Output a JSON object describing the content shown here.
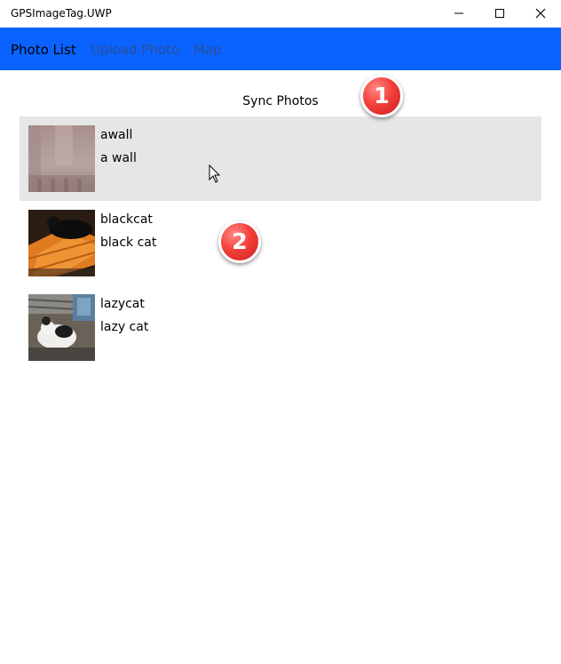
{
  "window": {
    "title": "GPSImageTag.UWP"
  },
  "nav": {
    "tabs": [
      {
        "label": "Photo List"
      },
      {
        "label": "Upload Photo"
      },
      {
        "label": "Map"
      }
    ]
  },
  "sync": {
    "label": "Sync Photos"
  },
  "badges": [
    "1",
    "2"
  ],
  "photos": [
    {
      "name": "awall",
      "description": "a wall"
    },
    {
      "name": "blackcat",
      "description": "black cat"
    },
    {
      "name": "lazycat",
      "description": "lazy cat"
    }
  ],
  "colors": {
    "accent": "#0a63ff",
    "selected_row": "#e6e6e6",
    "badge": "#f5403b"
  }
}
